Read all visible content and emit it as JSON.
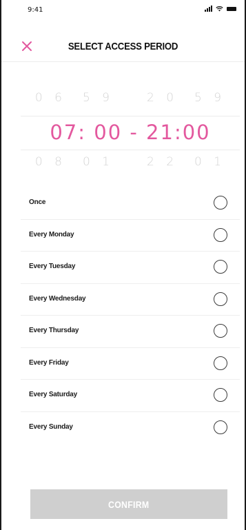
{
  "status_bar": {
    "time": "9:41"
  },
  "header": {
    "title": "SELECT ACCESS PERIOD"
  },
  "picker": {
    "prev": {
      "start_hour": "0 6",
      "start_minute": "5 9",
      "end_hour": "2 0",
      "end_minute": "5 9"
    },
    "current": {
      "value": "07: 00 - 21:00"
    },
    "next": {
      "start_hour": "0 8",
      "start_minute": "0 1",
      "end_hour": "2 2",
      "end_minute": "0 1"
    }
  },
  "options": [
    {
      "label": "Once",
      "selected": false
    },
    {
      "label": "Every Monday",
      "selected": false
    },
    {
      "label": "Every Tuesday",
      "selected": false
    },
    {
      "label": "Every Wednesday",
      "selected": false
    },
    {
      "label": "Every Thursday",
      "selected": false
    },
    {
      "label": "Every Friday",
      "selected": false
    },
    {
      "label": "Every Saturday",
      "selected": false
    },
    {
      "label": "Every Sunday",
      "selected": false
    }
  ],
  "confirm_label": "CONFIRM",
  "colors": {
    "accent": "#e3589e",
    "button_disabled": "#cfcfcf"
  },
  "icons": {
    "close": "close-icon",
    "radio": "radio-unchecked-icon"
  }
}
